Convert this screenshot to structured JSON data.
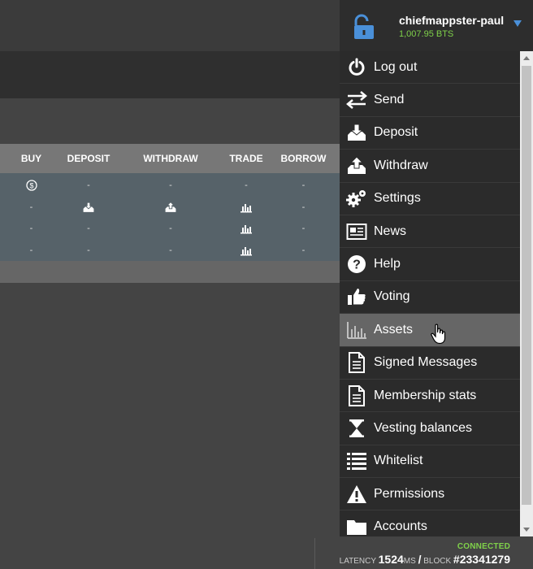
{
  "account": {
    "name": "chiefmappster-paul",
    "balance": "1,007.95 BTS",
    "lock_icon": "unlocked-padlock-icon",
    "accent": "#4a90d9",
    "balance_color": "#7fd14a"
  },
  "table": {
    "headers": [
      "BUY",
      "DEPOSIT",
      "WITHDRAW",
      "TRADE",
      "BORROW"
    ],
    "rows": [
      [
        "dollar-circle-icon",
        "-",
        "-",
        "-",
        "-"
      ],
      [
        "-",
        "deposit-icon",
        "withdraw-icon",
        "trade-chart-icon",
        "-"
      ],
      [
        "-",
        "-",
        "-",
        "trade-chart-icon",
        "-"
      ],
      [
        "-",
        "-",
        "-",
        "trade-chart-icon",
        "-"
      ]
    ]
  },
  "menu": {
    "items": [
      {
        "label": "Log out",
        "icon": "power-icon"
      },
      {
        "label": "Send",
        "icon": "transfer-arrows-icon"
      },
      {
        "label": "Deposit",
        "icon": "deposit-icon"
      },
      {
        "label": "Withdraw",
        "icon": "withdraw-icon"
      },
      {
        "label": "Settings",
        "icon": "gears-icon"
      },
      {
        "label": "News",
        "icon": "newspaper-icon"
      },
      {
        "label": "Help",
        "icon": "question-circle-icon"
      },
      {
        "label": "Voting",
        "icon": "thumbs-up-icon"
      },
      {
        "label": "Assets",
        "icon": "bar-chart-icon",
        "active": true
      },
      {
        "label": "Signed Messages",
        "icon": "document-icon"
      },
      {
        "label": "Membership stats",
        "icon": "document-icon"
      },
      {
        "label": "Vesting balances",
        "icon": "hourglass-icon"
      },
      {
        "label": "Whitelist",
        "icon": "list-icon"
      },
      {
        "label": "Permissions",
        "icon": "warning-icon"
      },
      {
        "label": "Accounts",
        "icon": "folder-icon"
      }
    ]
  },
  "status": {
    "connection": "CONNECTED",
    "latency_label": "LATENCY",
    "latency_value": "1524",
    "latency_unit": "MS",
    "separator": "/",
    "block_label": "BLOCK",
    "block_value": "#23341279",
    "connection_color": "#7fd14a"
  }
}
